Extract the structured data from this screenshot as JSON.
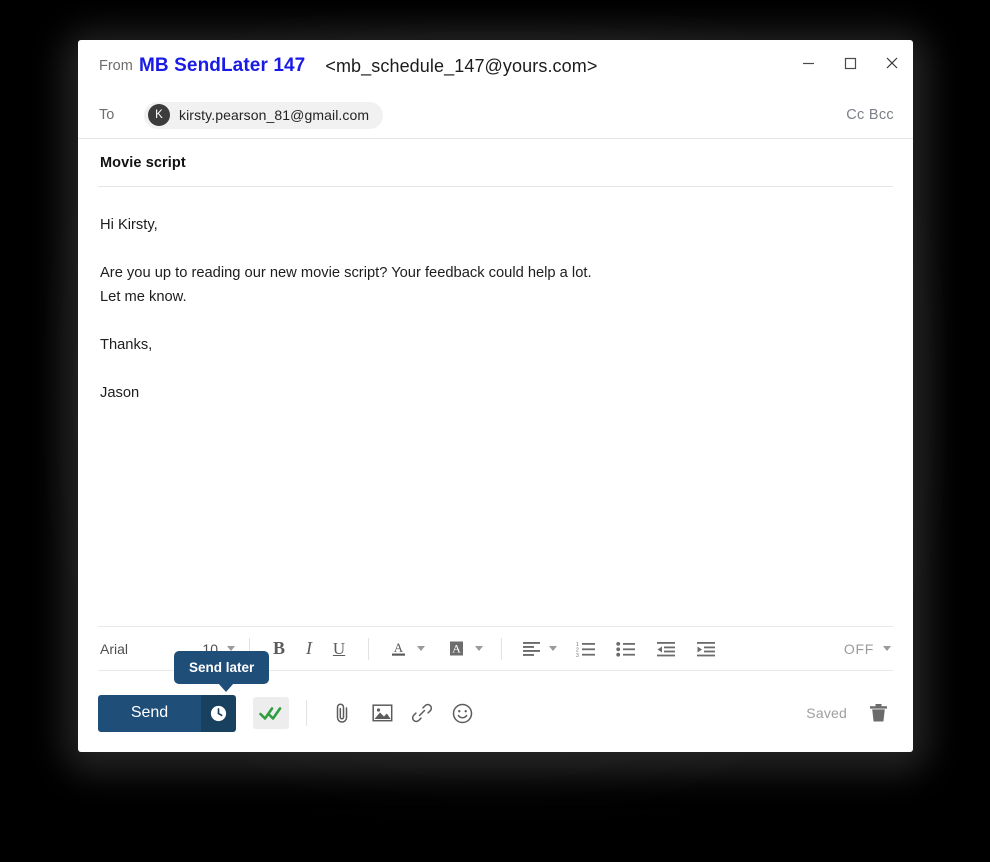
{
  "window": {
    "controls": {
      "minimize": "minimize-icon",
      "maximize": "maximize-icon",
      "close": "close-icon"
    }
  },
  "compose": {
    "from": {
      "label": "From",
      "display_name": "MB SendLater 147",
      "address": "<mb_schedule_147@yours.com>",
      "name_color": "#1a1ae6"
    },
    "to": {
      "label": "To",
      "avatar_initial": "K",
      "recipient": "kirsty.pearson_81@gmail.com",
      "cc_bcc": "Cc Bcc"
    },
    "subject": "Movie script",
    "body_lines": [
      "Hi Kirsty,",
      "",
      "Are you up to reading our new movie script? Your feedback could help a lot.",
      "Let me know.",
      "",
      "Thanks,",
      "",
      "Jason"
    ]
  },
  "format_toolbar": {
    "font_family": "Arial",
    "font_size": "10",
    "bold": "B",
    "italic": "I",
    "underline": "U",
    "font_color_icon": "font-color-icon",
    "highlight_color_icon": "highlight-color-icon",
    "align_icon": "align-left-icon",
    "numbered_list_icon": "numbered-list-icon",
    "bullet_list_icon": "bullet-list-icon",
    "outdent_icon": "outdent-icon",
    "indent_icon": "indent-icon",
    "tracking_state": "OFF"
  },
  "actions": {
    "send_label": "Send",
    "send_later_icon": "clock-icon",
    "send_later_tooltip": "Send later",
    "read_receipt_icon": "double-check-icon",
    "attach_icon": "paperclip-icon",
    "image_icon": "image-icon",
    "link_icon": "link-icon",
    "emoji_icon": "emoji-icon",
    "saved_status": "Saved",
    "discard_icon": "trash-icon"
  },
  "colors": {
    "accent_blue": "#1f4e79",
    "accent_blue_dark": "#18405f",
    "from_blue": "#1a1ae6",
    "check_green": "#2f9e41"
  }
}
